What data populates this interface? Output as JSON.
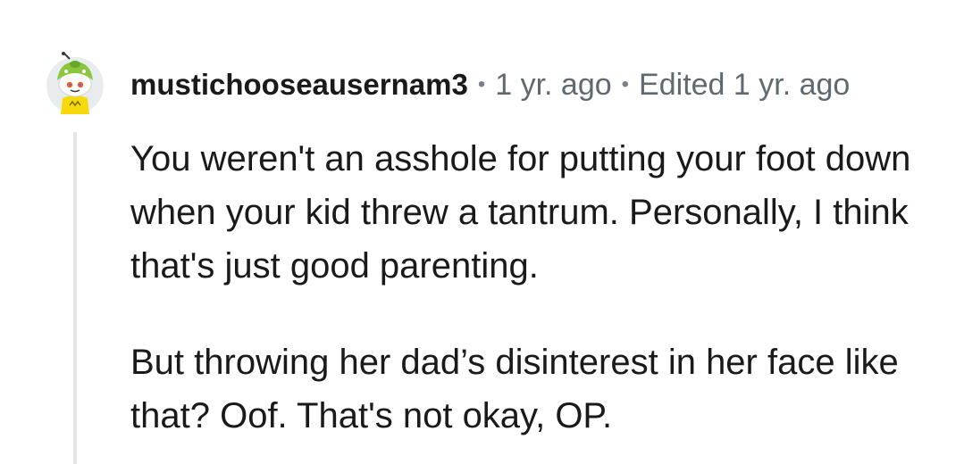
{
  "comment": {
    "username": "mustichooseausernam3",
    "separator": "•",
    "timestamp": "1 yr. ago",
    "edited": "Edited 1 yr. ago",
    "paragraphs": [
      "You weren't an asshole for putting your foot down when your kid threw a tantrum. Personally, I think that's just good parenting.",
      "But throwing her dad’s disinterest in her face like that? Oof. That's not okay, OP."
    ],
    "avatar_icon": "snoo-avatar-icon"
  },
  "colors": {
    "username": "#1a1a1b",
    "meta": "#5f6a70",
    "thread_line": "#e6e6e6",
    "avatar_bg": "#e9ecef",
    "avatar_hat": "#8cc63f",
    "avatar_shirt": "#f5d90a"
  }
}
